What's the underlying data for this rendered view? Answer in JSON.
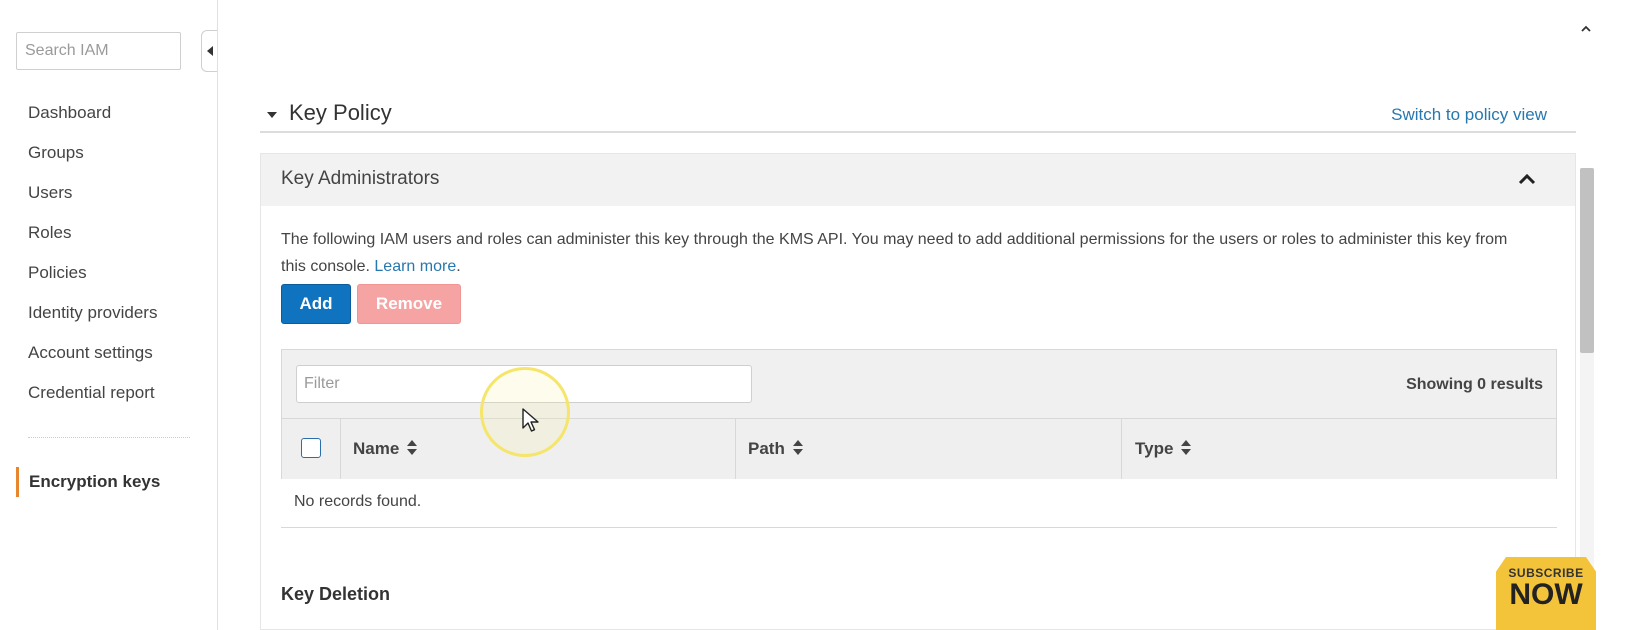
{
  "sidebar": {
    "search_placeholder": "Search IAM",
    "items": [
      {
        "label": "Dashboard"
      },
      {
        "label": "Groups"
      },
      {
        "label": "Users"
      },
      {
        "label": "Roles"
      },
      {
        "label": "Policies"
      },
      {
        "label": "Identity providers"
      },
      {
        "label": "Account settings"
      },
      {
        "label": "Credential report"
      }
    ],
    "active_item": "Encryption keys"
  },
  "key_policy": {
    "title": "Key Policy",
    "switch_link": "Switch to policy view"
  },
  "key_administrators": {
    "title": "Key Administrators",
    "description": "The following IAM users and roles can administer this key through the KMS API. You may need to add additional permissions for the users or roles to administer this key from this console.",
    "learn_more": "Learn more",
    "add_label": "Add",
    "remove_label": "Remove",
    "filter_placeholder": "Filter",
    "showing": "Showing 0 results",
    "columns": [
      "Name",
      "Path",
      "Type"
    ],
    "empty_text": "No records found."
  },
  "key_deletion": {
    "title": "Key Deletion"
  },
  "badge": {
    "top": "SUBSCRIBE",
    "main": "NOW"
  },
  "colors": {
    "primary_button": "#0f73c0",
    "disabled_remove": "#f5a3a3",
    "active_accent": "#e7862e",
    "link": "#2778ae"
  }
}
